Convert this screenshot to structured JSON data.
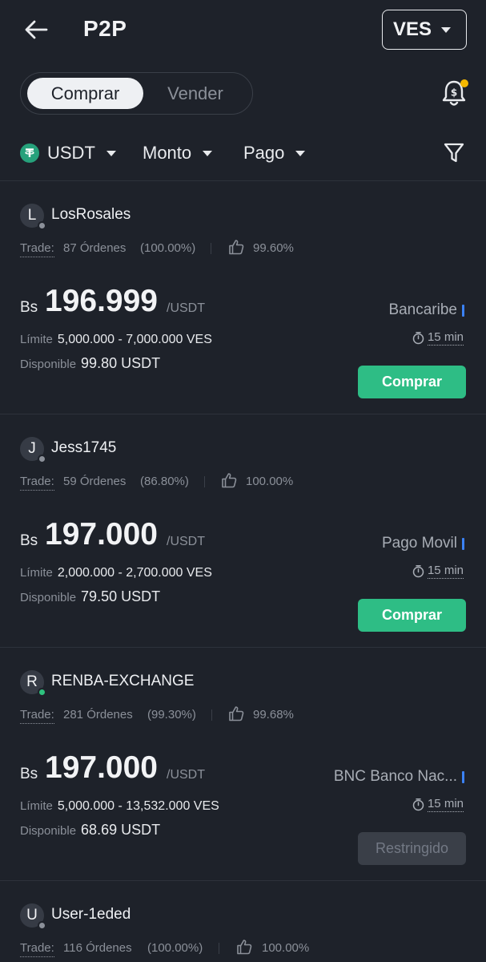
{
  "header": {
    "title": "P2P",
    "currency": "VES"
  },
  "mode": {
    "active": "Comprar",
    "inactive": "Vender"
  },
  "filters": {
    "asset": "USDT",
    "amount": "Monto",
    "payment": "Pago"
  },
  "colors": {
    "background": "#1e222a",
    "buy_button": "#2ebd85",
    "online": "#2ec27e",
    "offline": "#8b9099",
    "notification_dot": "#f5b800",
    "pay_method_bar": "#3b82f6"
  },
  "icons": {
    "back": "arrow-left-icon",
    "bell": "bell-dollar-icon",
    "filter": "funnel-icon",
    "asset": "tether-icon",
    "rating": "thumbs-up-icon",
    "time": "timer-icon"
  },
  "labels": {
    "trade": "Trade:",
    "limit": "Límite",
    "available": "Disponible",
    "currency": "Bs",
    "per_unit": "/USDT"
  },
  "offers": [
    {
      "initial": "L",
      "name": "LosRosales",
      "status": "offline",
      "orders": "87 Órdenes",
      "completion": "(100.00%)",
      "rating": "99.60%",
      "price": "196.999",
      "limit": "5,000.000 - 7,000.000 VES",
      "available": "99.80 USDT",
      "payment": "Bancaribe",
      "time": "15 min",
      "button": "Comprar",
      "button_type": "buy"
    },
    {
      "initial": "J",
      "name": "Jess1745",
      "status": "offline",
      "orders": "59 Órdenes",
      "completion": "(86.80%)",
      "rating": "100.00%",
      "price": "197.000",
      "limit": "2,000.000 - 2,700.000 VES",
      "available": "79.50 USDT",
      "payment": "Pago Movil",
      "time": "15 min",
      "button": "Comprar",
      "button_type": "buy"
    },
    {
      "initial": "R",
      "name": "RENBA-EXCHANGE",
      "status": "online",
      "orders": "281 Órdenes",
      "completion": "(99.30%)",
      "rating": "99.68%",
      "price": "197.000",
      "limit": "5,000.000 - 13,532.000 VES",
      "available": "68.69 USDT",
      "payment": "BNC Banco Nac...",
      "time": "15 min",
      "button": "Restringido",
      "button_type": "restricted"
    },
    {
      "initial": "U",
      "name": "User-1eded",
      "status": "offline",
      "orders": "116 Órdenes",
      "completion": "(100.00%)",
      "rating": "100.00%"
    }
  ]
}
